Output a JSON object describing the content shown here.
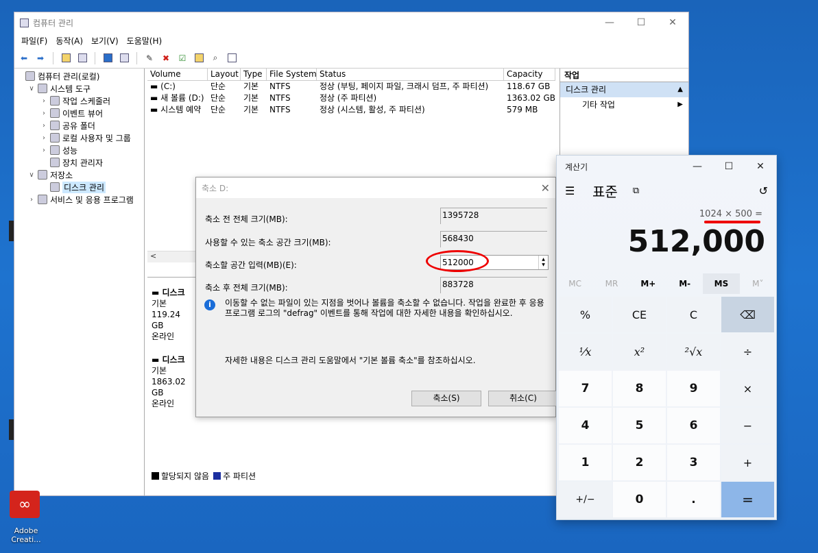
{
  "cm": {
    "title": "컴퓨터 관리",
    "menu": [
      "파일(F)",
      "동작(A)",
      "보기(V)",
      "도움말(H)"
    ],
    "tree": [
      {
        "label": "컴퓨터 관리(로컬)",
        "level": 0,
        "exp": ""
      },
      {
        "label": "시스템 도구",
        "level": 1,
        "exp": "∨"
      },
      {
        "label": "작업 스케줄러",
        "level": 2,
        "exp": "›"
      },
      {
        "label": "이벤트 뷰어",
        "level": 2,
        "exp": "›"
      },
      {
        "label": "공유 폴더",
        "level": 2,
        "exp": "›"
      },
      {
        "label": "로컬 사용자 및 그룹",
        "level": 2,
        "exp": "›"
      },
      {
        "label": "성능",
        "level": 2,
        "exp": "›"
      },
      {
        "label": "장치 관리자",
        "level": 2,
        "exp": ""
      },
      {
        "label": "저장소",
        "level": 1,
        "exp": "∨"
      },
      {
        "label": "디스크 관리",
        "level": 2,
        "exp": ""
      },
      {
        "label": "서비스 및 응용 프로그램",
        "level": 1,
        "exp": "›"
      }
    ],
    "columns": [
      "Volume",
      "Layout",
      "Type",
      "File System",
      "Status",
      "Capacity"
    ],
    "volumes": [
      [
        "(C:)",
        "단순",
        "기본",
        "NTFS",
        "정상 (부팅, 페이지 파일, 크래시 덤프, 주 파티션)",
        "118.67 GB"
      ],
      [
        "새 볼륨 (D:)",
        "단순",
        "기본",
        "NTFS",
        "정상 (주 파티션)",
        "1363.02 GB"
      ],
      [
        "시스템 예약",
        "단순",
        "기본",
        "NTFS",
        "정상 (시스템, 활성, 주 파티션)",
        "579 MB"
      ]
    ],
    "disks": [
      {
        "name": "디스크",
        "type": "기본",
        "size": "119.24 GB",
        "state": "온라인"
      },
      {
        "name": "디스크",
        "type": "기본",
        "size": "1863.02 GB",
        "state": "온라인"
      }
    ],
    "legend": {
      "unallocated": "할당되지 않음",
      "primary": "주 파티션"
    },
    "actions": {
      "header": "작업",
      "item": "디스크 관리",
      "sub": "기타 작업"
    }
  },
  "dialog": {
    "title": "축소 D:",
    "rows": [
      {
        "label": "축소 전 전체 크기(MB):",
        "value": "1395728"
      },
      {
        "label": "사용할 수 있는 축소 공간 크기(MB):",
        "value": "568430"
      },
      {
        "label": "축소할 공간 입력(MB)(E):",
        "value": "512000"
      },
      {
        "label": "축소 후 전체 크기(MB):",
        "value": "883728"
      }
    ],
    "info": "이동할 수 없는 파일이 있는 지점을 벗어나 볼륨을 축소할 수 없습니다. 작업을 완료한 후 응용 프로그램 로그의 \"defrag\" 이벤트를 통해 작업에 대한 자세한 내용을 확인하십시오.",
    "help": "자세한 내용은 디스크 관리 도움말에서 \"기본 볼륨 축소\"를 참조하십시오.",
    "ok": "축소(S)",
    "cancel": "취소(C)"
  },
  "calc": {
    "title": "계산기",
    "mode": "표준",
    "expression": "1024 × 500 =",
    "result": "512,000",
    "memory": [
      "MC",
      "MR",
      "M+",
      "M-",
      "MS",
      "M˅"
    ],
    "keys": [
      "%",
      "CE",
      "C",
      "⌫",
      "¹⁄x",
      "x²",
      "²√x",
      "÷",
      "7",
      "8",
      "9",
      "×",
      "4",
      "5",
      "6",
      "−",
      "1",
      "2",
      "3",
      "+",
      "+/−",
      "0",
      ".",
      "="
    ]
  },
  "desktop": {
    "icon_label_1": "Adobe",
    "icon_label_2": "Creati..."
  },
  "colors": {
    "accent": "#e00000",
    "selection": "#cce8ff",
    "equals": "#8db6e8"
  }
}
